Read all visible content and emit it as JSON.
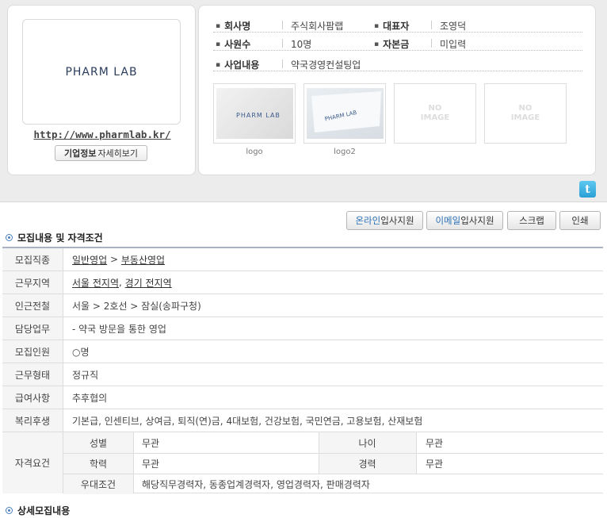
{
  "company": {
    "logo_text": "PHARM LAB",
    "homepage": "http://www.pharmlab.kr/",
    "detail_button": {
      "bold": "기업정보",
      "rest": "자세히보기"
    },
    "info": [
      {
        "label": "회사명",
        "value": "주식회사팜랩"
      },
      {
        "label": "대표자",
        "value": "조영덕"
      },
      {
        "label": "사원수",
        "value": "10명"
      },
      {
        "label": "자본금",
        "value": "미입력"
      },
      {
        "label": "사업내용",
        "value": "약국경영컨설팅업"
      }
    ],
    "images": [
      {
        "caption": "logo"
      },
      {
        "caption": "logo2"
      },
      {
        "caption": "",
        "placeholder": "NO\nIMAGE"
      },
      {
        "caption": "",
        "placeholder": "NO\nIMAGE"
      }
    ]
  },
  "actions": {
    "online_hl": "온라인",
    "online_rest": "입사지원",
    "email_hl": "이메일",
    "email_rest": "입사지원",
    "scrap": "스크랩",
    "print": "인쇄"
  },
  "section1_title": "모집내용 및 자격조건",
  "recruit": {
    "job_type": {
      "label": "모집직종",
      "parts": [
        "일반영업",
        " > ",
        "부동산영업"
      ]
    },
    "location": {
      "label": "근무지역",
      "parts": [
        "서울 전지역",
        ", ",
        "경기 전지역"
      ]
    },
    "subway": {
      "label": "인근전철",
      "value": "서울 > 2호선 > 잠실(송파구청)"
    },
    "duty": {
      "label": "담당업무",
      "value": "- 약국 방문을 통한 영업"
    },
    "headcount": {
      "label": "모집인원",
      "value": "○명"
    },
    "employment": {
      "label": "근무형태",
      "value": "정규직"
    },
    "salary": {
      "label": "급여사항",
      "value": "추후협의"
    },
    "welfare": {
      "label": "복리후생",
      "value": "기본급, 인센티브, 상여금, 퇴직(연)금, 4대보험, 건강보험, 국민연금, 고용보험, 산재보험"
    },
    "qualification": {
      "label": "자격요건",
      "gender": {
        "label": "성별",
        "value": "무관"
      },
      "age": {
        "label": "나이",
        "value": "무관"
      },
      "education": {
        "label": "학력",
        "value": "무관"
      },
      "career": {
        "label": "경력",
        "value": "무관"
      },
      "preference": {
        "label": "우대조건",
        "value": "해당직무경력자, 동종업계경력자, 영업경력자, 판매경력자"
      }
    }
  },
  "section2_title": "상세모집내용"
}
